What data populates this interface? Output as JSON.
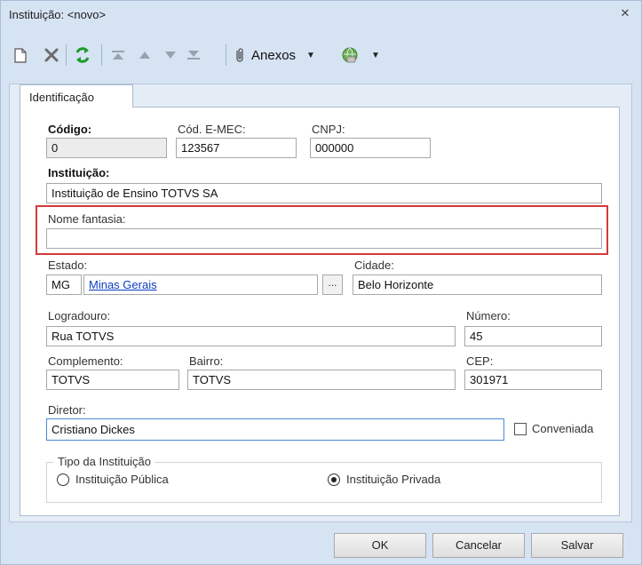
{
  "window": {
    "title": "Instituição: <novo>",
    "close_glyph": "✕"
  },
  "toolbar": {
    "icons": [
      "new-document-icon",
      "delete-icon",
      "refresh-icon",
      "first-record-icon",
      "previous-record-icon",
      "next-record-icon",
      "last-record-icon",
      "paperclip-icon",
      "globe-icon"
    ],
    "anexos_label": "Anexos",
    "accent_refresh": "#1f9a2a"
  },
  "tabs": [
    {
      "label": "Identificação"
    }
  ],
  "form": {
    "codigo": {
      "label": "Código:",
      "value": "0"
    },
    "cod_emec": {
      "label": "Cód. E-MEC:",
      "value": "123567"
    },
    "cnpj": {
      "label": "CNPJ:",
      "value": "000000"
    },
    "instituicao": {
      "label": "Instituição:",
      "value": "Instituição de Ensino TOTVS SA"
    },
    "nome_fantasia": {
      "label": "Nome fantasia:",
      "value": ""
    },
    "estado": {
      "label": "Estado:",
      "uf": "MG",
      "name": "Minas Gerais",
      "lookup_label": "..."
    },
    "cidade": {
      "label": "Cidade:",
      "value": "Belo Horizonte"
    },
    "logradouro": {
      "label": "Logradouro:",
      "value": "Rua TOTVS"
    },
    "numero": {
      "label": "Número:",
      "value": "45"
    },
    "complemento": {
      "label": "Complemento:",
      "value": "TOTVS"
    },
    "bairro": {
      "label": "Bairro:",
      "value": "TOTVS"
    },
    "cep": {
      "label": "CEP:",
      "value": "301971"
    },
    "diretor": {
      "label": "Diretor:",
      "value": "Cristiano Dickes"
    },
    "conveniada": {
      "label": "Conveniada",
      "checked": false
    },
    "tipo": {
      "label": "Tipo da Instituição",
      "options": [
        {
          "label": "Instituição Pública",
          "checked": false
        },
        {
          "label": "Instituição Privada",
          "checked": true
        }
      ]
    },
    "highlight_color": "#d63a3a"
  },
  "footer": {
    "ok_label": "OK",
    "cancel_label": "Cancelar",
    "save_label": "Salvar"
  }
}
